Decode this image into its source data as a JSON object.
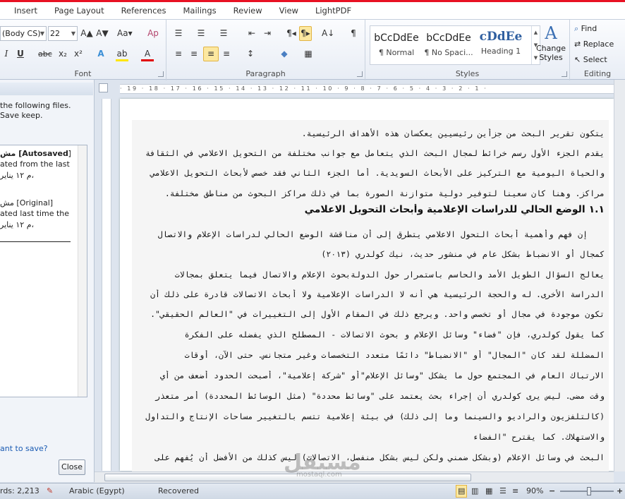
{
  "tabs": [
    "Insert",
    "Page Layout",
    "References",
    "Mailings",
    "Review",
    "View",
    "LightPDF"
  ],
  "font": {
    "name": "(Body CS)",
    "size": "22",
    "group_label": "Font",
    "row1": [
      "A▲",
      "A▼",
      "Aa▾",
      "Ap"
    ],
    "row2": [
      "I",
      "U",
      "abc",
      "x₂",
      "x²",
      "A",
      "ab",
      "A"
    ]
  },
  "paragraph": {
    "group_label": "Paragraph",
    "row1": [
      "☰",
      "☰",
      "☰",
      "⇤",
      "⇥",
      "¶◂",
      "¶▸",
      "A↓",
      "¶"
    ],
    "row2": [
      "≡",
      "≡",
      "≡",
      "≡",
      "↕",
      "◆",
      "▦"
    ]
  },
  "styles": {
    "group_label": "Styles",
    "items": [
      {
        "sample": "bCcDdEe",
        "label": "¶ Normal"
      },
      {
        "sample": "bCcDdEe",
        "label": "¶ No Spaci..."
      },
      {
        "sample": "cDdEe",
        "label": "Heading 1"
      }
    ],
    "change_label": "Change Styles"
  },
  "editing": {
    "group_label": "Editing",
    "find": "Find",
    "replace": "Replace",
    "select": "Select"
  },
  "recovery": {
    "message": "the following files.  Save keep.",
    "files": [
      {
        "title": "مش [Autosaved]",
        "desc": "ated from the last ...",
        "time": "م ١٢ يناير،"
      },
      {
        "title": "مش  [Original]",
        "desc": "ated last time the ...",
        "time": "م ١٢ يناير،"
      }
    ],
    "want_save": "ant to save?",
    "close": "Close"
  },
  "ruler": {
    "ticks": "· 19 · 18 · 17 · 16 · 15 · 14 · 13 · 12 · 11 · 10 · 9 · 8 · 7 · 6 · 5 · 4 · 3 · 2 · 1 ·"
  },
  "document": {
    "lines": [
      "يتكون تقرير البحث من جزأين رئيسيين يعكسان هذه الأهداف الرئيسية.",
      "يقدم الجزء الأول رسم خرائط لمجال البحث الذي يتعامل مع جوانب مختلفة من التحويل الاعلامي في الثقافة",
      "والحياة اليومية مع التركيز على الأبحاث السويدية. أما الجزء الثاني فقد خصص لأبحاث التحويل الاعلامي",
      "مراكز. وهنا كان سعينا لتوفير دولية متوازنة الصورة بما في ذلك مراكز البحوث من مناطق مختلفة.",
      "١.١  الوضع الحالي للدراسات الإعلامية وأبحاث التحويل الاعلامي",
      "إن فهم وأهمية أبحاث التحول الاعلامي  يتطرق إلى أن مناقشة الوضع الحالي لدراسات الإعلام والاتصال",
      "كمجال أو الانضباط بشكل عام في منشور حديث، نيك كولدري (٢٠١٣)",
      "يعالج السؤال الطويل الأمد والحاسم باستمرار حول الدولةبحوث الإعلام والاتصال فيما يتعلق بمجالات",
      "الدراسة الأخرى. له والحجة الرئيسية هي أنه لا الدراسات الإعلامية ولا أبحاث الاتصالات قادرة على ذلك أن",
      "تكون موجودة في مجال أو تخصص واحد. ويرجع ذلك في المقام الأول إلى التغييرات في \"العالم الحقيقي\".",
      "كما يقول كولدري، فإن \"فضاء\" وسائل الإعلام و بحوث الاتصالات - المصطلح الذي يفضله على الفكرة",
      "المضللة لقد كان \"المجال\" أو \"الانضباط\" دائمًا متعدد التخصصات وغير متجانس. حتى الآن، أوقات",
      "الارتباك العام في المجتمع حول ما يشكل \"وسائل الإعلام\"أو \"شركة إعلامية\"، أصبحت الحدود أضعف من أي",
      "وقت مضى. ليس يرى كولدري أن إجراء بحث يعتمد على \"وسائط محددة\" (مثل الوسائط المحددة) أمر متعذر",
      "(كالتلفزيون والراديو والسينما وما إلى ذلك) في بيئة إعلامية تتسم بالتغيير مساحات الإنتاج والتداول",
      "والاستهلاك. كما يقترح \"الفضاء",
      "البحث في وسائل الإعلام (وبشكل ضمني ولكن ليس بشكل منفصل، الاتصالات) ليس كذلك من الأفضل أن يُفهم على"
    ]
  },
  "status": {
    "words": "rds: 2,213",
    "language": "Arabic (Egypt)",
    "state": "Recovered",
    "zoom": "90%"
  },
  "watermark": {
    "logo": "مستقل",
    "url": "mostaql.com"
  }
}
